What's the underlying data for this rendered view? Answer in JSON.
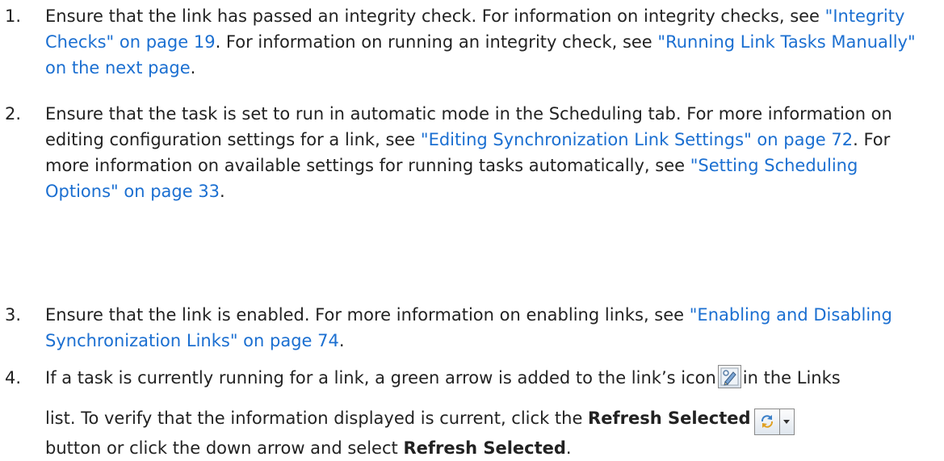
{
  "steps": [
    {
      "num": "1.",
      "t1": "Ensure that the link has passed an integrity check. For information on integrity checks, see ",
      "l1": "\"Integrity Checks\" on page 19",
      "t2": ". For information on running an integrity check, see ",
      "l2": "\"Running Link Tasks Manually\" on the next page",
      "t3": "."
    },
    {
      "num": "2.",
      "t1": "Ensure that the task is set to run in automatic mode in the Scheduling tab. For more information on editing configuration settings for a link, see ",
      "l1": "\"Editing Synchronization Link Settings\" on page 72",
      "t2": ". For more information on available settings for running tasks automatically, see ",
      "l2": "\"Setting Scheduling Options\" on page 33",
      "t3": "."
    },
    {
      "num": "3.",
      "t1": "Ensure that the link is enabled. For more information on enabling links, see ",
      "l1": "\"Enabling and Disabling Synchronization Links\" on page 74",
      "t2": "."
    },
    {
      "num": "4.",
      "t1": "If a task is currently running for a link, a green arrow is added to the link’s icon",
      "t2": "in the Links",
      "t3": "list. To verify that the information displayed is current, click the ",
      "b1": "Refresh Selected",
      "t4": "button or click the down arrow and select ",
      "b2": "Refresh Selected",
      "t5": "."
    }
  ],
  "icons": {
    "link_icon": "link-pencil-icon",
    "refresh_icon": "refresh-arrows-icon",
    "dropdown_icon": "dropdown-arrow-icon"
  },
  "colors": {
    "link": "#1b6fd1",
    "text": "#222222"
  }
}
